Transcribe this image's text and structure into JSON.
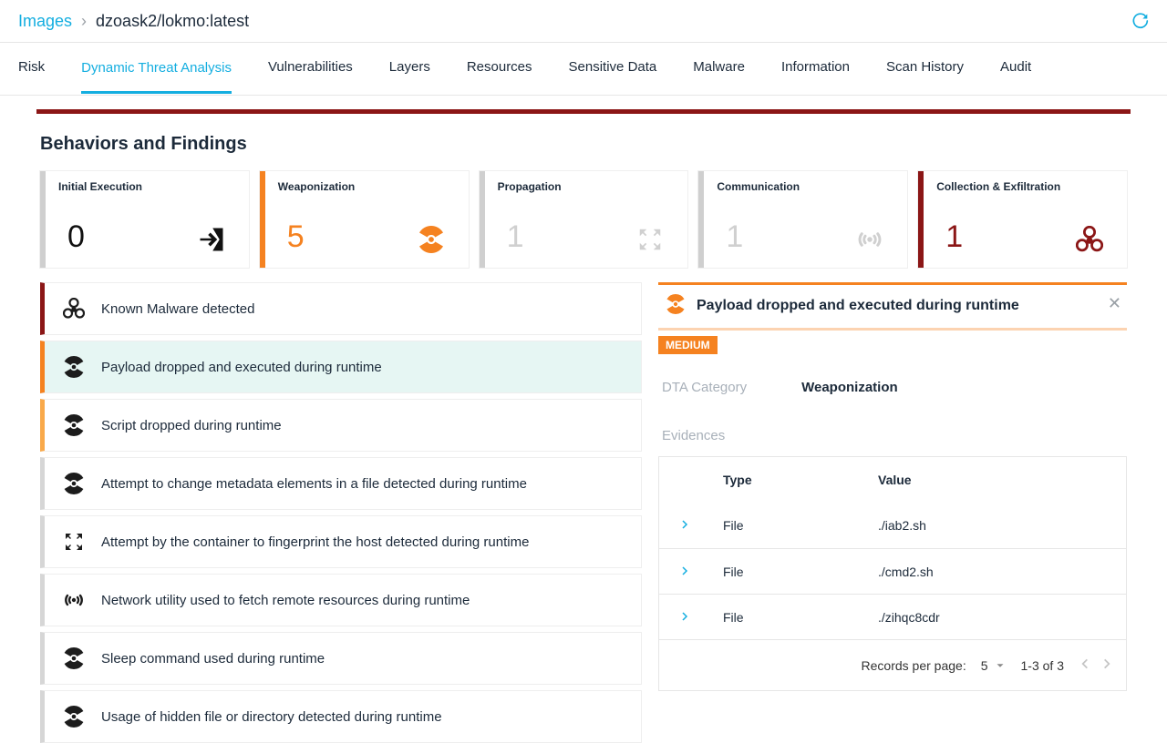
{
  "breadcrumb": {
    "link": "Images",
    "current": "dzoask2/lokmo:latest"
  },
  "tabs": [
    "Risk",
    "Dynamic Threat Analysis",
    "Vulnerabilities",
    "Layers",
    "Resources",
    "Sensitive Data",
    "Malware",
    "Information",
    "Scan History",
    "Audit"
  ],
  "active_tab": "Dynamic Threat Analysis",
  "section_title": "Behaviors and Findings",
  "cards": [
    {
      "key": "initial",
      "title": "Initial Execution",
      "value": "0",
      "accent": "gray",
      "icon": "entry-icon",
      "muted": false
    },
    {
      "key": "weapon",
      "title": "Weaponization",
      "value": "5",
      "accent": "orange",
      "icon": "radiation-icon",
      "muted": false
    },
    {
      "key": "propagation",
      "title": "Propagation",
      "value": "1",
      "accent": "gray",
      "icon": "expand-icon",
      "muted": true
    },
    {
      "key": "communication",
      "title": "Communication",
      "value": "1",
      "accent": "gray",
      "icon": "signal-icon",
      "muted": true
    },
    {
      "key": "exfil",
      "title": "Collection & Exfiltration",
      "value": "1",
      "accent": "maroon",
      "icon": "biohazard-icon",
      "muted": false
    }
  ],
  "findings": [
    {
      "icon": "biohazard-icon",
      "label": "Known Malware detected",
      "sev": "high"
    },
    {
      "icon": "radiation-icon",
      "label": "Payload dropped and executed during runtime",
      "sev": "med",
      "active": true
    },
    {
      "icon": "radiation-icon",
      "label": "Script dropped during runtime",
      "sev": "med-l"
    },
    {
      "icon": "radiation-icon",
      "label": "Attempt to change metadata elements in a file detected during runtime",
      "sev": "none"
    },
    {
      "icon": "expand-icon",
      "label": "Attempt by the container to fingerprint the host detected during runtime",
      "sev": "none"
    },
    {
      "icon": "signal-icon",
      "label": "Network utility used to fetch remote resources during runtime",
      "sev": "none"
    },
    {
      "icon": "radiation-icon",
      "label": "Sleep command used during runtime",
      "sev": "none"
    },
    {
      "icon": "radiation-icon",
      "label": "Usage of hidden file or directory detected during runtime",
      "sev": "none"
    }
  ],
  "detail": {
    "icon": "radiation-icon",
    "title": "Payload dropped and executed during runtime",
    "severity_label": "MEDIUM",
    "category_label": "DTA Category",
    "category_value": "Weaponization",
    "evidences_label": "Evidences",
    "table": {
      "headers": {
        "type": "Type",
        "value": "Value"
      },
      "rows": [
        {
          "type": "File",
          "value": "./iab2.sh"
        },
        {
          "type": "File",
          "value": "./cmd2.sh"
        },
        {
          "type": "File",
          "value": "./zihqc8cdr"
        }
      ]
    },
    "pager": {
      "label": "Records per page:",
      "per_page": "5",
      "range": "1-3 of 3"
    }
  }
}
